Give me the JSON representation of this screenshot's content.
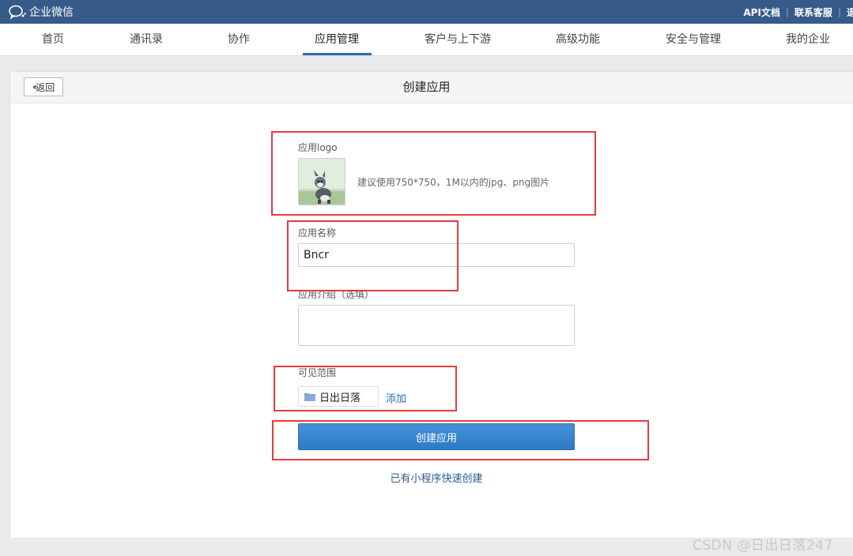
{
  "topbar": {
    "brand": "企业微信",
    "links": [
      "API文档",
      "联系客服",
      "退"
    ]
  },
  "nav": {
    "items": [
      "首页",
      "通讯录",
      "协作",
      "应用管理",
      "客户与上下游",
      "高级功能",
      "安全与管理",
      "我的企业"
    ],
    "active": "应用管理"
  },
  "panel": {
    "back_label": "返回",
    "title": "创建应用"
  },
  "form": {
    "logo_label": "应用logo",
    "logo_hint": "建议使用750*750，1M以内的jpg、png图片",
    "name_label": "应用名称",
    "name_value": "Bncr",
    "intro_label": "应用介绍（选填）",
    "intro_value": "",
    "scope_label": "可见范围",
    "scope_value": "日出日落",
    "scope_add": "添加",
    "create_button": "创建应用",
    "mini_program_link": "已有小程序快速创建"
  },
  "watermark": "CSDN @日出日落247",
  "colors": {
    "topbar": "#365a8a",
    "primary_button": "#3a87d0",
    "link": "#2d6cb0",
    "annotation": "#e53b3b"
  }
}
